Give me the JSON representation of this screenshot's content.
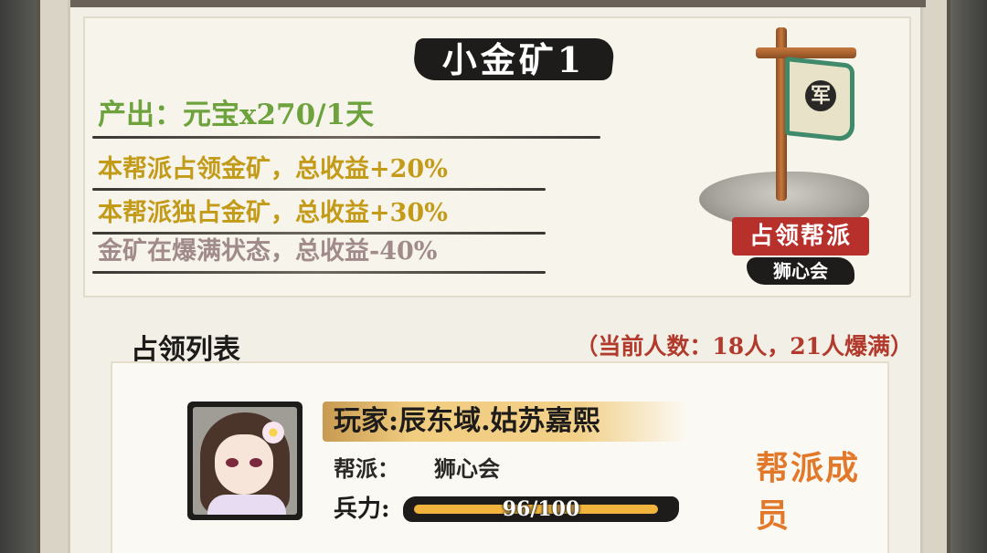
{
  "mine": {
    "title": "小金矿1",
    "output": "产出：元宝x270/1天",
    "bonuses": [
      {
        "text": "本帮派占领金矿，总收益+20%",
        "color": "#c39b18"
      },
      {
        "text": "本帮派独占金矿，总收益+30%",
        "color": "#c39b18"
      },
      {
        "text": "金矿在爆满状态，总收益-40%",
        "color": "#a08a8a"
      }
    ],
    "flag_glyph": "军",
    "occupy_label": "占领帮派",
    "occupying_guild": "狮心会"
  },
  "occupation_list": {
    "title": "占领列表",
    "count_text": "（当前人数：18人，21人爆满）"
  },
  "member": {
    "avatar_icon": "character-portrait",
    "player_name": "玩家:辰东域.姑苏嘉熙",
    "guild_label": "帮派：",
    "guild_value": "狮心会",
    "power_label": "兵力:",
    "power_text": "96/100",
    "power_current": 96,
    "power_max": 100,
    "role": "帮派成员"
  },
  "colors": {
    "output_green": "#6da23c",
    "bonus_gold": "#c39b18",
    "penalty_grey": "#a08a8a",
    "banner_red": "#b8302b",
    "role_orange": "#e2782a",
    "power_fill": "#f2b43c"
  }
}
